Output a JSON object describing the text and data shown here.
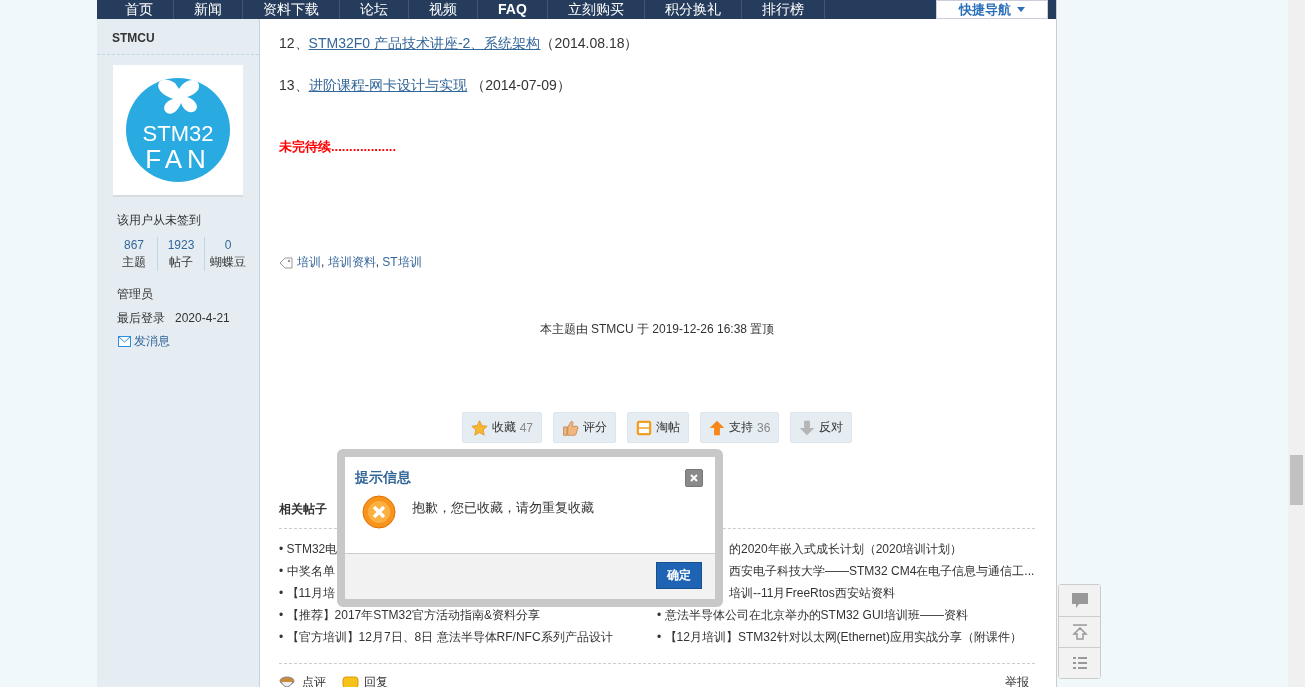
{
  "nav": {
    "items": [
      {
        "label": "首页",
        "selected": false
      },
      {
        "label": "新闻",
        "selected": false
      },
      {
        "label": "资料下载",
        "selected": false
      },
      {
        "label": "论坛",
        "selected": false
      },
      {
        "label": "视频",
        "selected": false
      },
      {
        "label": "FAQ",
        "selected": true
      },
      {
        "label": "立刻购买",
        "selected": false
      },
      {
        "label": "积分换礼",
        "selected": false
      },
      {
        "label": "排行榜",
        "selected": false
      }
    ],
    "quick_nav": "快捷导航"
  },
  "sidebar": {
    "username": "STMCU",
    "avatar_lines": [
      "STM32",
      "FAN"
    ],
    "sign_status": "该用户从未签到",
    "stats": [
      {
        "value": "867",
        "label": "主题"
      },
      {
        "value": "1923",
        "label": "帖子"
      },
      {
        "value": "0",
        "label": "蝴蝶豆"
      }
    ],
    "group": "管理员",
    "last_login_label": "最后登录",
    "last_login": "2020-4-21",
    "message_link": "发消息"
  },
  "post": {
    "lines": [
      {
        "number": "12、",
        "link": "STM32F0 产品技术讲座-2、系统架构",
        "date": "（2014.08.18）"
      },
      {
        "number": "13、",
        "link": "进阶课程-网卡设计与实现",
        "date": " （2014-07-09）"
      }
    ],
    "to_be_continued": "未完待续..................",
    "tags": [
      "培训",
      "培训资料",
      "ST培训"
    ],
    "tag_separator": ", ",
    "pinned_note": "本主题由 STMCU 于 2019-12-26 16:38 置顶",
    "actions": [
      {
        "kind": "favorite",
        "label": "收藏",
        "count": "47"
      },
      {
        "kind": "rate",
        "label": "评分"
      },
      {
        "kind": "collect",
        "label": "淘帖"
      },
      {
        "kind": "support",
        "label": "支持",
        "count": "36"
      },
      {
        "kind": "oppose",
        "label": "反对"
      }
    ]
  },
  "related": {
    "title": "相关帖子",
    "bullet": "•",
    "left": [
      {
        "text": "STM32电"
      },
      {
        "text": "中奖名单"
      },
      {
        "text": "【11月培"
      },
      {
        "text": "【推荐】2017年STM32官方活动指南&资料分享"
      },
      {
        "text": "【官方培训】12月7日、8日 意法半导体RF/NFC系列产品设计"
      }
    ],
    "right": [
      {
        "text": "的2020年嵌入式成长计划（2020培训计划）",
        "kind": "partial"
      },
      {
        "text": "西安电子科技大学——STM32 CM4在电子信息与通信工...",
        "kind": "partial"
      },
      {
        "text": "培训--11月FreeRtos西安站资料",
        "kind": "partial"
      },
      {
        "text": "意法半导体公司在北京举办的STM32 GUI培训班——资料",
        "kind": "full"
      },
      {
        "text": "【12月培训】STM32针对以太网(Ethernet)应用实战分享（附课件）",
        "kind": "full"
      }
    ]
  },
  "footer": {
    "comment": "点评",
    "reply": "回复",
    "report": "举报"
  },
  "dialog": {
    "title": "提示信息",
    "message": "抱歉，您已收藏，请勿重复收藏",
    "confirm": "确定"
  }
}
